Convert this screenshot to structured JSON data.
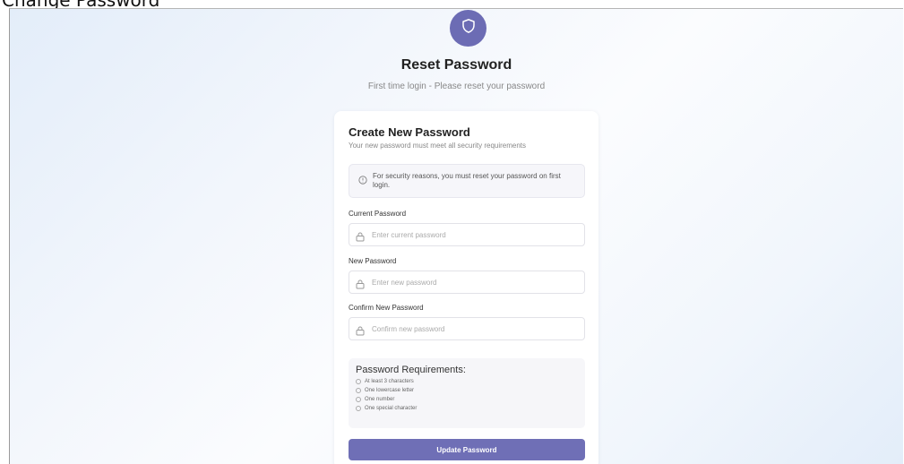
{
  "doc_caption": "Change Password",
  "header": {
    "title": "Reset Password",
    "subtitle": "First time login - Please reset your password",
    "badge_icon": "shield-icon",
    "accent_color": "#6c6cb4"
  },
  "card": {
    "title": "Create New Password",
    "description": "Your new password must meet all security requirements",
    "notice": {
      "icon": "info-icon",
      "text": "For security reasons, you must reset your password on first login."
    },
    "fields": {
      "current": {
        "label": "Current Password",
        "placeholder": "Enter current password",
        "value": ""
      },
      "new": {
        "label": "New Password",
        "placeholder": "Enter new password",
        "value": ""
      },
      "confirm": {
        "label": "Confirm New Password",
        "placeholder": "Confirm new password",
        "value": ""
      }
    },
    "requirements": {
      "title": "Password Requirements:",
      "items": [
        {
          "label": "At least 3 characters",
          "met": false
        },
        {
          "label": "One lowercase letter",
          "met": false
        },
        {
          "label": "One number",
          "met": false
        },
        {
          "label": "One special character",
          "met": false
        }
      ]
    },
    "submit_label": "Update Password",
    "button_color": "#6f6fb6"
  }
}
